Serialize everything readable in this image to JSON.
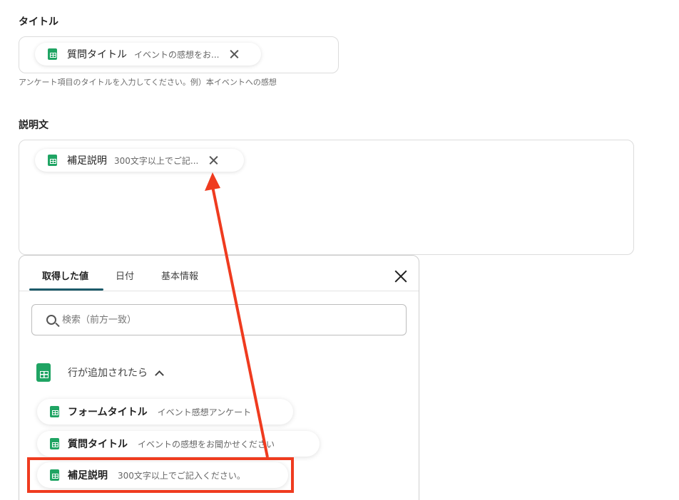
{
  "title_field": {
    "label": "タイトル",
    "chip": {
      "title": "質問タイトル",
      "value": "イベントの感想をお..."
    },
    "help": "アンケート項目のタイトルを入力してください。例）本イベントへの感想"
  },
  "description_field": {
    "label": "説明文",
    "chip": {
      "title": "補足説明",
      "value": "300文字以上でご記..."
    }
  },
  "panel": {
    "tabs": [
      "取得した値",
      "日付",
      "基本情報"
    ],
    "active_tab": 0,
    "search_placeholder": "検索（前方一致）",
    "group": {
      "title": "行が追加されたら",
      "items": [
        {
          "title": "フォームタイトル",
          "value": "イベント感想アンケート"
        },
        {
          "title": "質問タイトル",
          "value": "イベントの感想をお聞かせください"
        },
        {
          "title": "補足説明",
          "value": "300文字以上でご記入ください。"
        }
      ]
    }
  },
  "annotation_color": "#ef3b1f",
  "sheet_icon_color": "#1fa463"
}
